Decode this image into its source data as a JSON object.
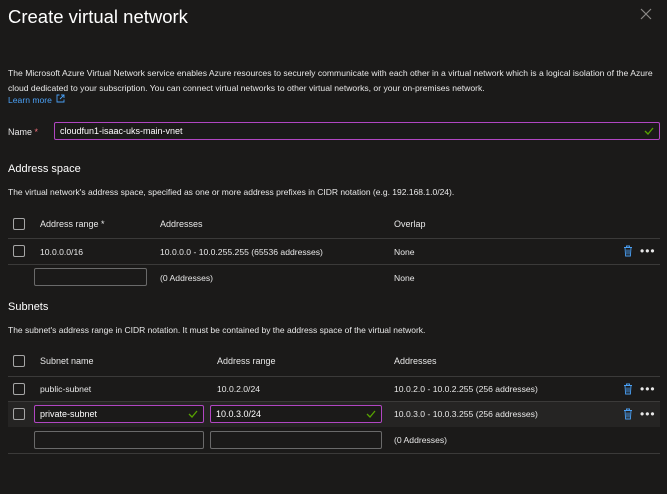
{
  "title": "Create virtual network",
  "description": "The Microsoft Azure Virtual Network service enables Azure resources to securely communicate with each other in a virtual network which is a logical isolation of the Azure cloud dedicated to your subscription. You can connect virtual networks to other virtual networks, or your on-premises network.",
  "learn_more": "Learn more",
  "name": {
    "label": "Name",
    "required_mark": "*",
    "value": "cloudfun1-isaac-uks-main-vnet"
  },
  "address_space": {
    "heading": "Address space",
    "description": "The virtual network's address space, specified as one or more address prefixes in CIDR notation (e.g. 192.168.1.0/24).",
    "columns": [
      "Address range *",
      "Addresses",
      "Overlap"
    ],
    "rows": [
      {
        "range": "10.0.0.0/16",
        "addresses": "10.0.0.0 - 10.0.255.255 (65536 addresses)",
        "overlap": "None"
      }
    ],
    "new_row": {
      "range_value": "",
      "addresses": "(0 Addresses)",
      "overlap": "None"
    }
  },
  "subnets": {
    "heading": "Subnets",
    "description": "The subnet's address range in CIDR notation. It must be contained by the address space of the virtual network.",
    "columns": [
      "Subnet name",
      "Address range",
      "Addresses"
    ],
    "rows": [
      {
        "name": "public-subnet",
        "range": "10.0.2.0/24",
        "addresses": "10.0.2.0 - 10.0.2.255 (256 addresses)"
      },
      {
        "name": "private-subnet",
        "range": "10.0.3.0/24",
        "addresses": "10.0.3.0 - 10.0.3.255 (256 addresses)"
      }
    ],
    "new_row": {
      "name_value": "",
      "range_value": "",
      "addresses": "(0 Addresses)"
    }
  },
  "colors": {
    "background": "#1b1a19",
    "link": "#4aa0f5",
    "focus_border": "#b146c2",
    "valid_check": "#57a300",
    "delete_icon": "#4aa0f5",
    "required": "#f1707b"
  }
}
